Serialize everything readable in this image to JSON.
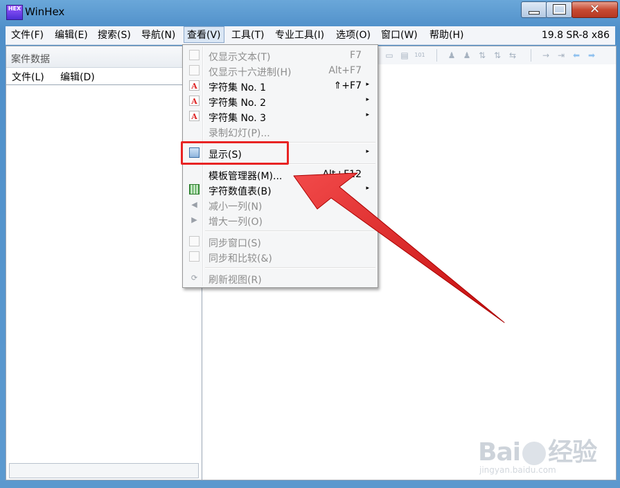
{
  "window": {
    "title": "WinHex",
    "icon_text": "HEX",
    "controls": {
      "minimize": "minimize",
      "maximize": "maximize",
      "close": "✕"
    }
  },
  "menubar": {
    "items": [
      "文件(F)",
      "编辑(E)",
      "搜索(S)",
      "导航(N)",
      "查看(V)",
      "工具(T)",
      "专业工具(I)",
      "选项(O)",
      "窗口(W)",
      "帮助(H)"
    ],
    "active": "查看(V)",
    "version": "19.8 SR-8 x86"
  },
  "left_panel": {
    "title": "案件数据",
    "menu": [
      "文件(L)",
      "编辑(D)"
    ]
  },
  "dropdown": {
    "items": [
      {
        "label": "仅显示文本(T)",
        "shortcut": "F7",
        "icon": "checkbox-icon",
        "enabled": false,
        "submenu": false
      },
      {
        "label": "仅显示十六进制(H)",
        "shortcut": "Alt+F7",
        "icon": "checkbox-icon",
        "enabled": false,
        "submenu": false
      },
      {
        "label": "字符集 No. 1",
        "shortcut": "⇑+F7",
        "icon": "font-icon",
        "enabled": true,
        "submenu": true
      },
      {
        "label": "字符集 No. 2",
        "shortcut": "",
        "icon": "font-icon",
        "enabled": true,
        "submenu": true
      },
      {
        "label": "字符集 No. 3",
        "shortcut": "",
        "icon": "font-icon",
        "enabled": true,
        "submenu": true
      },
      {
        "label": "录制幻灯(P)...",
        "shortcut": "",
        "icon": "",
        "enabled": false,
        "submenu": false
      },
      {
        "label": "显示(S)",
        "shortcut": "",
        "icon": "display-icon",
        "enabled": true,
        "submenu": true
      },
      {
        "label": "模板管理器(M)...",
        "shortcut": "Alt+F12",
        "icon": "",
        "enabled": true,
        "submenu": false
      },
      {
        "label": "字符数值表(B)",
        "shortcut": "",
        "icon": "table-icon",
        "enabled": true,
        "submenu": true
      },
      {
        "label": "减小一列(N)",
        "shortcut": "",
        "icon": "triangle-left-icon",
        "enabled": false,
        "submenu": false
      },
      {
        "label": "增大一列(O)",
        "shortcut": "",
        "icon": "triangle-right-icon",
        "enabled": false,
        "submenu": false
      },
      {
        "label": "同步窗口(S)",
        "shortcut": "",
        "icon": "checkbox-icon",
        "enabled": false,
        "submenu": false
      },
      {
        "label": "同步和比较(&)",
        "shortcut": "",
        "icon": "checkbox-icon",
        "enabled": false,
        "submenu": false
      },
      {
        "label": "刷新视图(R)",
        "shortcut": "",
        "icon": "refresh-icon",
        "enabled": false,
        "submenu": false
      }
    ],
    "submenu_glyph": "▸",
    "icon_glyphs": {
      "font": "A",
      "triangle_left": "◀",
      "triangle_right": "▶",
      "refresh": "⟳"
    }
  },
  "annotation": {
    "highlight_target": "显示(S)",
    "arrow_target": "模板管理器(M)...",
    "color": "#e82323"
  },
  "watermark": {
    "logo": "Bai",
    "logo_suffix": "经验",
    "url": "jingyan.baidu.com"
  }
}
